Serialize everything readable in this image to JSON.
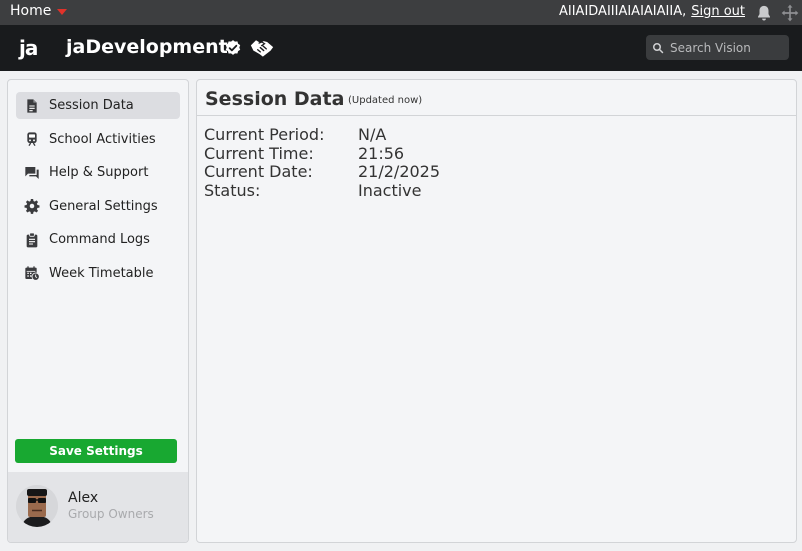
{
  "topbar": {
    "home_label": "Home",
    "username": "AIIAIDAIIIAIAIAIAIIA,",
    "signout_label": "Sign out"
  },
  "brand": {
    "logo_text": "ja",
    "name": "jaDevelopment",
    "verified_icon": "verified-icon",
    "partner_icon": "handshake-icon"
  },
  "search": {
    "placeholder": "Search Vision"
  },
  "sidebar": {
    "items": [
      {
        "label": "Session Data",
        "icon": "document-icon",
        "active": true
      },
      {
        "label": "School Activities",
        "icon": "train-icon"
      },
      {
        "label": "Help & Support",
        "icon": "chat-icon"
      },
      {
        "label": "General Settings",
        "icon": "gear-icon"
      },
      {
        "label": "Command Logs",
        "icon": "clipboard-icon"
      },
      {
        "label": "Week Timetable",
        "icon": "calendar-clock-icon"
      }
    ],
    "save_label": "Save Settings"
  },
  "profile": {
    "name": "Alex",
    "role": "Group Owners"
  },
  "main": {
    "title": "Session Data",
    "updated": "(Updated now)",
    "fields": [
      {
        "label": "Current Period:",
        "value": "N/A"
      },
      {
        "label": "Current Time:",
        "value": "21:56"
      },
      {
        "label": "Current Date:",
        "value": "21/2/2025"
      },
      {
        "label": "Status:",
        "value": "Inactive"
      }
    ]
  },
  "colors": {
    "topbar_bg": "#3d3e40",
    "brandbar_bg": "#191b1d",
    "accent_red": "#e0322a",
    "save_green": "#18a831"
  }
}
